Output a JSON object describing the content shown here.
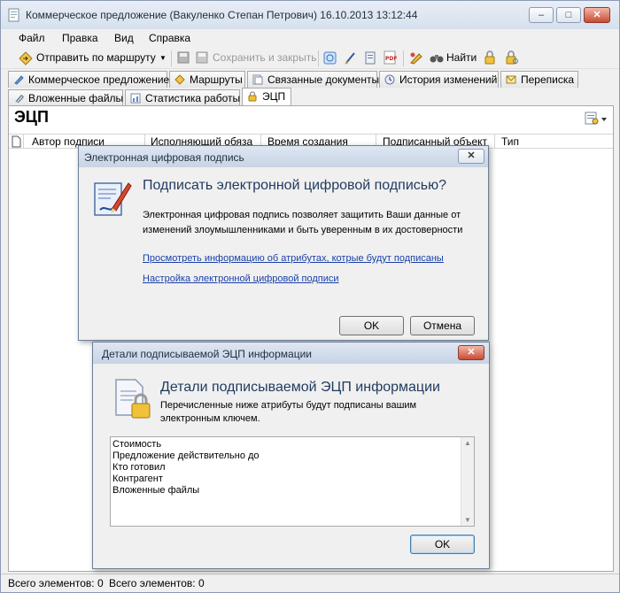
{
  "window": {
    "title": "Коммерческое предложение (Вакуленко Степан Петрович) 16.10.2013 13:12:44",
    "buttons": {
      "minimize": "–",
      "maximize": "□",
      "close": "✕"
    }
  },
  "menu": [
    "Файл",
    "Правка",
    "Вид",
    "Справка"
  ],
  "toolbar": {
    "send_route": "Отправить по маршруту",
    "save_close": "Сохранить и закрыть",
    "find": "Найти"
  },
  "tabs": {
    "row1": [
      "Коммерческое предложение",
      "Маршруты",
      "Связанные документы",
      "История изменений",
      "Переписка"
    ],
    "row2": [
      "Вложенные файлы",
      "Статистика работы",
      "ЭЦП"
    ],
    "active": "ЭЦП"
  },
  "content": {
    "title": "ЭЦП",
    "columns": [
      "Автор подписи",
      "Исполняющий обяза",
      "Время создания",
      "Подписанный объект",
      "Тип"
    ]
  },
  "status": {
    "left": "Всего элементов: 0",
    "right": "Всего элементов: 0"
  },
  "sign_dialog": {
    "title": "Электронная цифровая подпись",
    "close": "✕",
    "heading": "Подписать электронной цифровой подписью?",
    "text_line1": "Электронная цифровая подпись позволяет защитить Ваши данные от",
    "text_line2": "изменений злоумышленниками и быть уверенным в их достоверности",
    "link_attributes": "Просмотреть информацию об атрибутах, котрые будут подписаны",
    "link_settings": "Настройка электронной цифровой подписи",
    "ok": "OK",
    "cancel": "Отмена"
  },
  "details_dialog": {
    "title": "Детали подписываемой ЭЦП информации",
    "close": "✕",
    "heading": "Детали подписываемой ЭЦП информации",
    "text_line1": "Перечисленные ниже атрибуты будут подписаны вашим",
    "text_line2": "электронным ключем.",
    "items": [
      "Стоимость",
      "Предложение действительно до",
      "Кто готовил",
      "Контрагент",
      "Вложенные файлы"
    ],
    "ok": "OK"
  },
  "colors": {
    "link": "#1a3fa8",
    "heading": "#1f3a5f",
    "close_red": "#c94a33"
  }
}
